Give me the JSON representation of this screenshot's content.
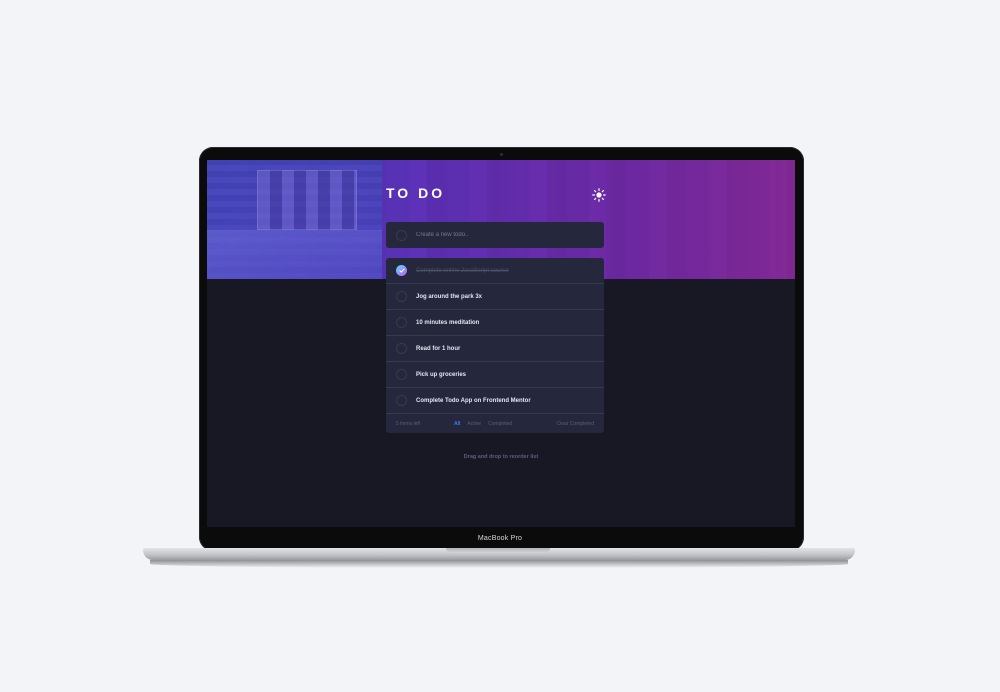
{
  "device": {
    "label": "MacBook Pro"
  },
  "app": {
    "title": "TO DO",
    "theme_toggle_icon": "sun-icon",
    "new_todo_placeholder": "Create a new todo..",
    "todos": [
      {
        "text": "Complete online JavaScript course",
        "completed": true
      },
      {
        "text": "Jog around the park 3x",
        "completed": false
      },
      {
        "text": "10 minutes meditation",
        "completed": false
      },
      {
        "text": "Read for 1 hour",
        "completed": false
      },
      {
        "text": "Pick up groceries",
        "completed": false
      },
      {
        "text": "Complete Todo App on Frontend Mentor",
        "completed": false
      }
    ],
    "footer": {
      "items_left": "5 items left",
      "filters": [
        "All",
        "Active",
        "Completed"
      ],
      "active_filter": "All",
      "clear_label": "Clear Completed"
    },
    "hint": "Drag and drop to reorder list"
  },
  "colors": {
    "accent": "#3a7cfd",
    "background": "#181824",
    "card": "#25273c",
    "check_gradient_start": "#57ddff",
    "check_gradient_end": "#c058f3"
  }
}
